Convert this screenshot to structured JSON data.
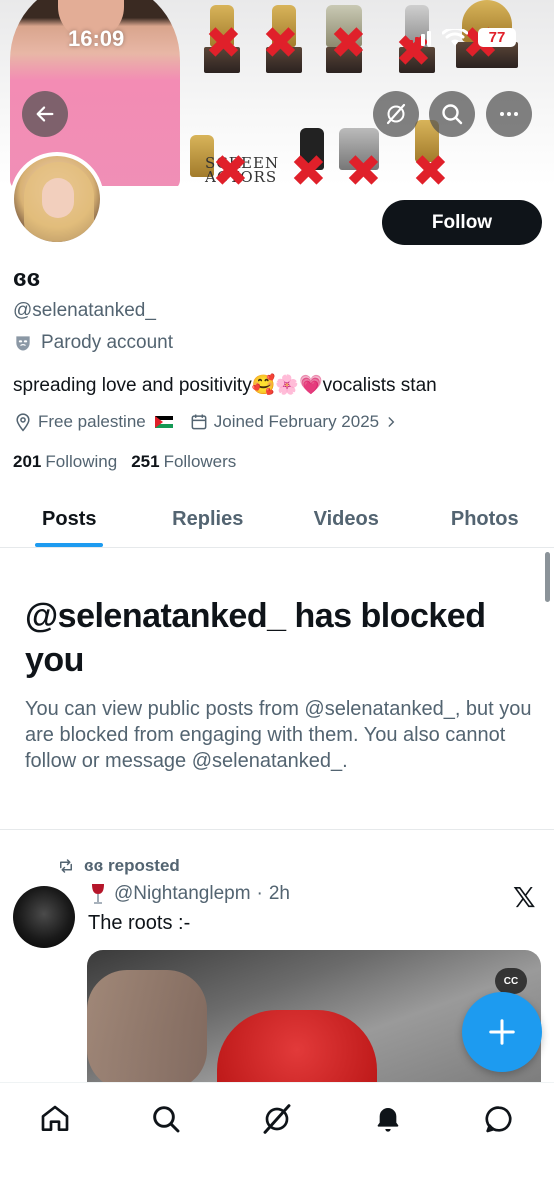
{
  "status_bar": {
    "time": "16:09",
    "battery": "77"
  },
  "banner": {
    "sag_text_line1": "SCREEN",
    "sag_text_line2": "ACTORS"
  },
  "profile": {
    "display_name": "ɞɞ",
    "handle": "@selenatanked_",
    "parody_label": "Parody account",
    "bio": "spreading love and positivity🥰🌸💗vocalists stan",
    "location": "Free palestine",
    "joined": "Joined February 2025",
    "following_count": "201",
    "following_label": "Following",
    "followers_count": "251",
    "followers_label": "Followers",
    "follow_button": "Follow"
  },
  "tabs": [
    {
      "label": "Posts",
      "active": true
    },
    {
      "label": "Replies",
      "active": false
    },
    {
      "label": "Videos",
      "active": false
    },
    {
      "label": "Photos",
      "active": false
    }
  ],
  "blocked": {
    "title": "@selenatanked_ has blocked you",
    "description": "You can view public posts from @selenatanked_, but you are blocked from engaging with them. You also cannot follow or message @selenatanked_."
  },
  "post": {
    "repost_label": "ɞɞ reposted",
    "author_handle": "@Nightanglepm",
    "separator": "·",
    "time": "2h",
    "text": "The roots :-",
    "cc_label": "CC"
  },
  "icons": {
    "back": "arrow-left-icon",
    "grok": "grok-icon",
    "search": "search-icon",
    "more": "more-icon",
    "home": "home-icon",
    "notifications": "bell-icon",
    "messages": "message-icon",
    "compose": "plus-icon"
  },
  "colors": {
    "accent": "#1d9bf0",
    "text": "#0f1419",
    "secondary": "#536471",
    "x_mark": "#e0202a"
  }
}
